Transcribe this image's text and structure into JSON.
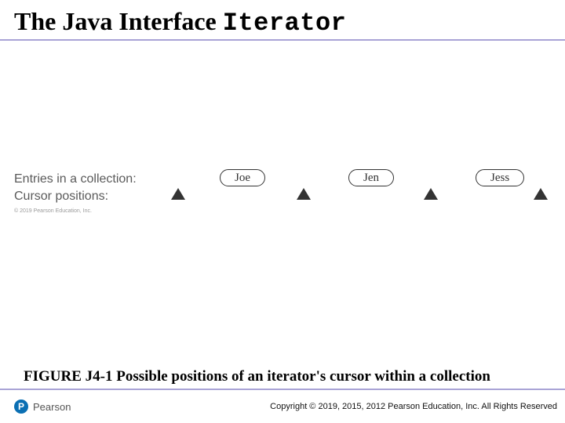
{
  "title": {
    "prefix": "The Java Interface ",
    "interface_name": "Iterator"
  },
  "diagram": {
    "label_entries": "Entries in a collection:",
    "label_cursor": "Cursor positions:",
    "small_copyright": "© 2019 Pearson Education, Inc.",
    "entries": [
      "Joe",
      "Jen",
      "Jess"
    ],
    "cursor_count": 4
  },
  "caption": "FIGURE J4-1 Possible positions of an iterator's cursor within a collection",
  "footer": {
    "logo_letter": "P",
    "brand": "Pearson",
    "copyright": "Copyright © 2019, 2015, 2012 Pearson Education, Inc. All Rights Reserved"
  }
}
